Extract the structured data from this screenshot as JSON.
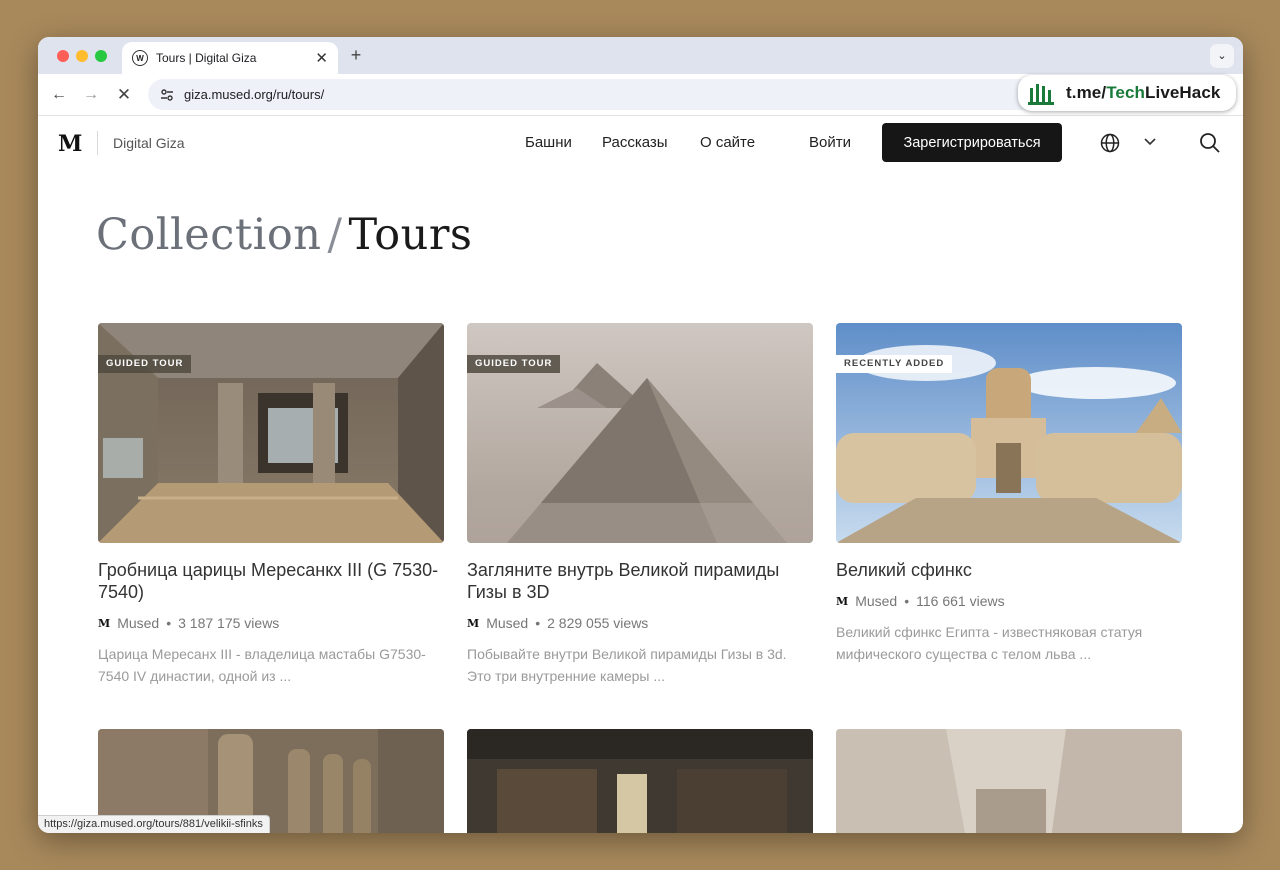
{
  "browser": {
    "tab_title": "Tours | Digital Giza",
    "tab_favicon_letter": "W",
    "url": "giza.mused.org/ru/tours/",
    "status_url": "https://giza.mused.org/tours/881/velikii-sfinks"
  },
  "watermark": {
    "prefix": "t.me/",
    "highlight": "Tech",
    "suffix": "LiveHack"
  },
  "header": {
    "logo": "M",
    "brand": "Digital Giza",
    "nav": [
      "Башни",
      "Рассказы",
      "О сайте"
    ],
    "login": "Войти",
    "signup": "Зарегистрироваться"
  },
  "page": {
    "crumb_parent": "Collection",
    "crumb_sep": "/",
    "crumb_current": "Tours"
  },
  "cards": [
    {
      "badge": "GUIDED TOUR",
      "title": "Гробница царицы Мересанкх III (G 7530-7540)",
      "author": "Mused",
      "views": "3 187 175 views",
      "description": "Царица Мересанх III - владелица мастабы G7530-7540 IV династии, одной из ..."
    },
    {
      "badge": "GUIDED TOUR",
      "title": "Загляните внутрь Великой пирамиды Гизы в 3D",
      "author": "Mused",
      "views": "2 829 055 views",
      "description": "Побывайте внутри Великой пирамиды Гизы в 3d. Это три внутренние камеры ..."
    },
    {
      "badge": "RECENTLY ADDED",
      "title": "Великий сфинкс",
      "author": "Mused",
      "views": "116 661 views",
      "description": "Великий сфинкс Египта - известняковая статуя мифического существа с телом льва ..."
    }
  ],
  "meta_separator": "•",
  "colors": {
    "background": "#a8895c",
    "signup_bg": "#161616",
    "badge_dark": "#504a40",
    "watermark_green": "#1a7a3a"
  }
}
